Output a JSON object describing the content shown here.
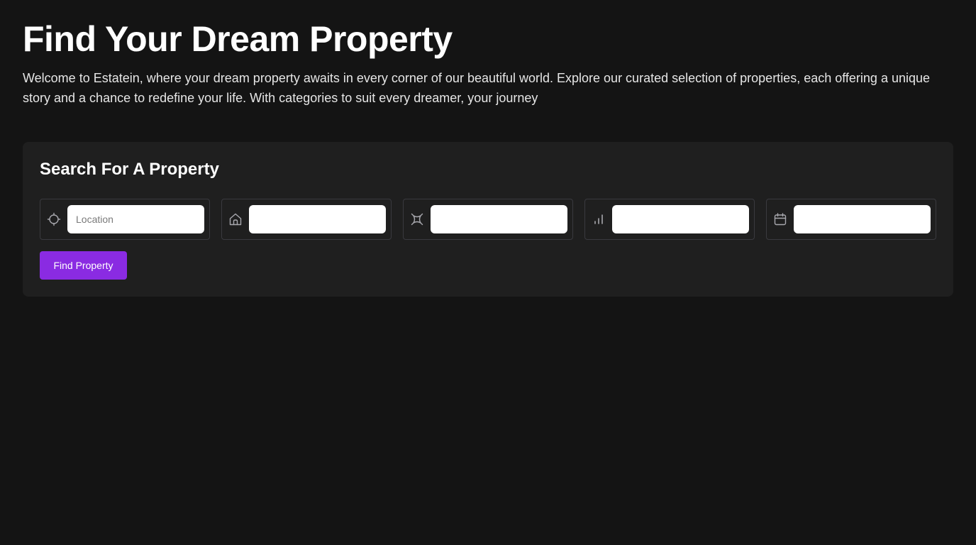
{
  "hero": {
    "title": "Find Your Dream Property",
    "description": "Welcome to Estatein, where your dream property awaits in every corner of our beautiful world. Explore our curated selection of properties, each offering a unique story and a chance to redefine your life. With categories to suit every dreamer, your journey"
  },
  "search": {
    "title": "Search For A Property",
    "filters": [
      {
        "icon": "crosshair-icon",
        "value": "",
        "placeholder": "Location"
      },
      {
        "icon": "home-icon",
        "value": "",
        "placeholder": ""
      },
      {
        "icon": "cube-icon",
        "value": "",
        "placeholder": ""
      },
      {
        "icon": "bar-chart-icon",
        "value": "",
        "placeholder": ""
      },
      {
        "icon": "calendar-icon",
        "value": "",
        "placeholder": ""
      }
    ],
    "button_label": "Find Property"
  },
  "colors": {
    "background": "#141414",
    "panel": "#1f1f1f",
    "accent": "#8a2be2",
    "border": "#3a3a3f"
  }
}
